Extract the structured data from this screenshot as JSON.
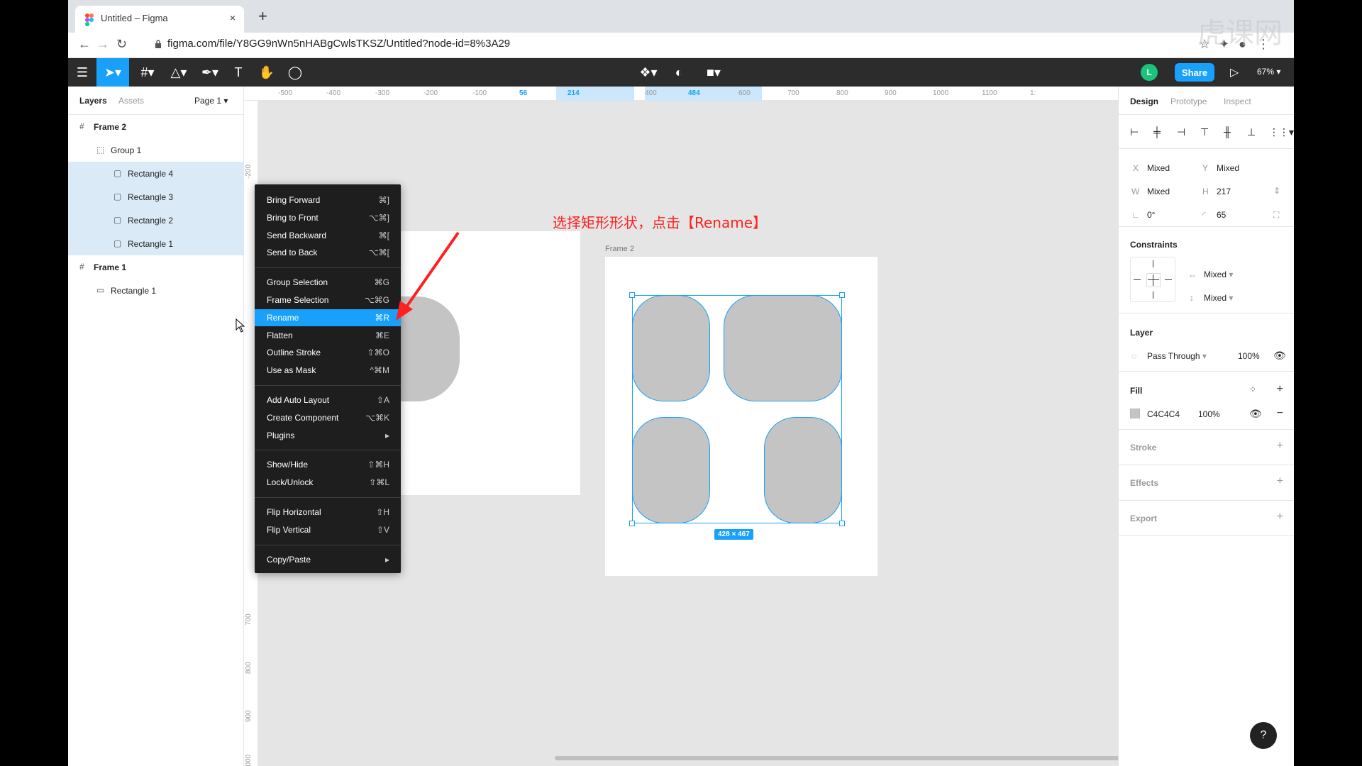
{
  "browser": {
    "tab_title": "Untitled – Figma",
    "tab_close": "×",
    "new_tab": "+",
    "url": "figma.com/file/Y8GG9nWn5nHABgCwlsTKSZ/Untitled?node-id=8%3A29"
  },
  "toolbar": {
    "avatar_letter": "L",
    "share_label": "Share",
    "zoom": "67%"
  },
  "left_panel": {
    "tabs": [
      "Layers",
      "Assets"
    ],
    "page": "Page 1",
    "layers": [
      {
        "name": "Frame 2",
        "selected": false
      },
      {
        "name": "Group 1",
        "selected": false
      },
      {
        "name": "Rectangle 4",
        "selected": true
      },
      {
        "name": "Rectangle 3",
        "selected": true
      },
      {
        "name": "Rectangle 2",
        "selected": true
      },
      {
        "name": "Rectangle 1",
        "selected": true
      },
      {
        "name": "Frame 1",
        "selected": false
      },
      {
        "name": "Rectangle 1",
        "selected": false
      }
    ]
  },
  "rulers": {
    "h": [
      "-500",
      "-400",
      "-300",
      "-200",
      "-100",
      "56",
      "214",
      "400",
      "484",
      "600",
      "700",
      "800",
      "900",
      "1000",
      "1100",
      "1:"
    ],
    "v": [
      "-200",
      "700",
      "800",
      "900",
      "1000"
    ]
  },
  "canvas": {
    "frame2_label": "Frame 2",
    "selection_size": "428 × 467"
  },
  "context_menu": {
    "items": [
      {
        "label": "Bring Forward",
        "shortcut": "⌘]"
      },
      {
        "label": "Bring to Front",
        "shortcut": "⌥⌘]"
      },
      {
        "label": "Send Backward",
        "shortcut": "⌘["
      },
      {
        "label": "Send to Back",
        "shortcut": "⌥⌘["
      },
      {
        "label": "Group Selection",
        "shortcut": "⌘G"
      },
      {
        "label": "Frame Selection",
        "shortcut": "⌥⌘G"
      },
      {
        "label": "Rename",
        "shortcut": "⌘R"
      },
      {
        "label": "Flatten",
        "shortcut": "⌘E"
      },
      {
        "label": "Outline Stroke",
        "shortcut": "⇧⌘O"
      },
      {
        "label": "Use as Mask",
        "shortcut": "^⌘M"
      },
      {
        "label": "Add Auto Layout",
        "shortcut": "⇧A"
      },
      {
        "label": "Create Component",
        "shortcut": "⌥⌘K"
      },
      {
        "label": "Plugins",
        "shortcut": "▸"
      },
      {
        "label": "Show/Hide",
        "shortcut": "⇧⌘H"
      },
      {
        "label": "Lock/Unlock",
        "shortcut": "⇧⌘L"
      },
      {
        "label": "Flip Horizontal",
        "shortcut": "⇧H"
      },
      {
        "label": "Flip Vertical",
        "shortcut": "⇧V"
      },
      {
        "label": "Copy/Paste",
        "shortcut": "▸"
      }
    ],
    "highlighted": "Rename"
  },
  "annotation": "选择矩形形状，点击【Rename】",
  "right_panel": {
    "tabs": [
      "Design",
      "Prototype",
      "Inspect"
    ],
    "x_label": "X",
    "x_value": "Mixed",
    "y_label": "Y",
    "y_value": "Mixed",
    "w_label": "W",
    "w_value": "Mixed",
    "h_label": "H",
    "h_value": "217",
    "rotation": "0°",
    "radius": "65",
    "constraints_title": "Constraints",
    "constraint_h": "Mixed",
    "constraint_v": "Mixed",
    "layer_title": "Layer",
    "blend_mode": "Pass Through",
    "layer_opacity": "100%",
    "fill_title": "Fill",
    "fill_hex": "C4C4C4",
    "fill_opacity": "100%",
    "stroke_title": "Stroke",
    "effects_title": "Effects",
    "export_title": "Export"
  },
  "help": "?",
  "colors": {
    "accent": "#18a0fb",
    "fill": "#c4c4c4",
    "toolbar": "#2c2c2c",
    "annotation": "#ff2020"
  }
}
